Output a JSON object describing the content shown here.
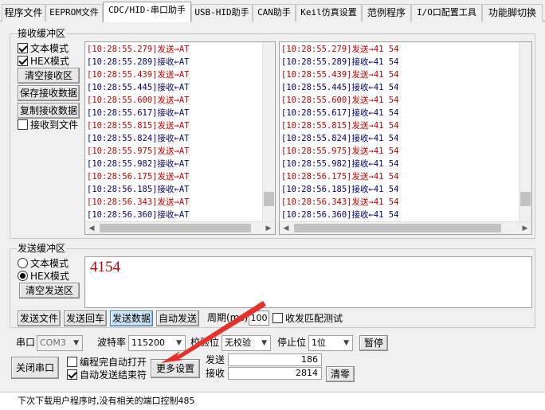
{
  "tabs": [
    {
      "label": "程序文件"
    },
    {
      "label": "EEPROM文件"
    },
    {
      "label": "CDC/HID-串口助手"
    },
    {
      "label": "USB-HID助手"
    },
    {
      "label": "CAN助手"
    },
    {
      "label": "Keil仿真设置"
    },
    {
      "label": "范例程序"
    },
    {
      "label": "I/O口配置工具"
    },
    {
      "label": "功能脚切换"
    }
  ],
  "receive": {
    "group_title": "接收缓冲区",
    "text_mode": "文本模式",
    "hex_mode": "HEX模式",
    "clear_button": "清空接收区",
    "save_button": "保存接收数据",
    "copy_button": "复制接收数据",
    "to_file": "接收到文件",
    "text_log": [
      {
        "text": "[10:28:55.279]发送→AT",
        "dir": "send"
      },
      {
        "text": "[10:28:55.289]接收←AT",
        "dir": "recv"
      },
      {
        "text": "[10:28:55.439]发送→AT",
        "dir": "send"
      },
      {
        "text": "[10:28:55.445]接收←AT",
        "dir": "recv"
      },
      {
        "text": "[10:28:55.600]发送→AT",
        "dir": "send"
      },
      {
        "text": "[10:28:55.617]接收←AT",
        "dir": "recv"
      },
      {
        "text": "[10:28:55.815]发送→AT",
        "dir": "send"
      },
      {
        "text": "[10:28:55.824]接收←AT",
        "dir": "recv"
      },
      {
        "text": "[10:28:55.975]发送→AT",
        "dir": "send"
      },
      {
        "text": "[10:28:55.982]接收←AT",
        "dir": "recv"
      },
      {
        "text": "[10:28:56.175]发送→AT",
        "dir": "send"
      },
      {
        "text": "[10:28:56.185]接收←AT",
        "dir": "recv"
      },
      {
        "text": "[10:28:56.343]发送→AT",
        "dir": "send"
      },
      {
        "text": "[10:28:56.360]接收←AT",
        "dir": "recv"
      }
    ],
    "hex_log": [
      {
        "text": "[10:28:55.279]发送→41 54",
        "dir": "send"
      },
      {
        "text": "[10:28:55.289]接收←41 54",
        "dir": "recv"
      },
      {
        "text": "[10:28:55.439]发送→41 54",
        "dir": "send"
      },
      {
        "text": "[10:28:55.445]接收←41 54",
        "dir": "recv"
      },
      {
        "text": "[10:28:55.600]发送→41 54",
        "dir": "send"
      },
      {
        "text": "[10:28:55.617]接收←41 54",
        "dir": "recv"
      },
      {
        "text": "[10:28:55.815]发送→41 54",
        "dir": "send"
      },
      {
        "text": "[10:28:55.824]接收←41 54",
        "dir": "recv"
      },
      {
        "text": "[10:28:55.975]发送→41 54",
        "dir": "send"
      },
      {
        "text": "[10:28:55.982]接收←41 54",
        "dir": "recv"
      },
      {
        "text": "[10:28:56.175]发送→41 54",
        "dir": "send"
      },
      {
        "text": "[10:28:56.185]接收←41 54",
        "dir": "recv"
      },
      {
        "text": "[10:28:56.343]发送→41 54",
        "dir": "send"
      },
      {
        "text": "[10:28:56.360]接收←41 54",
        "dir": "recv"
      }
    ]
  },
  "send": {
    "group_title": "发送缓冲区",
    "text_mode": "文本模式",
    "hex_mode": "HEX模式",
    "clear_button": "清空发送区",
    "content": "4154",
    "send_file": "发送文件",
    "send_enter": "发送回车",
    "send_data": "发送数据",
    "auto_send": "自动发送",
    "period_label": "周期(ms)",
    "period_value": "100",
    "match_test": "收发匹配测试"
  },
  "port": {
    "port_label": "串口",
    "port_value": "COM3",
    "baud_label": "波特率",
    "baud_value": "115200",
    "parity_label": "校验位",
    "parity_value": "无校验",
    "stop_label": "停止位",
    "stop_value": "1位",
    "pause_button": "暂停",
    "close_button": "关闭串口",
    "auto_open": "编程完自动打开",
    "auto_send_end": "自动发送结束符",
    "more_settings": "更多设置",
    "sent_label": "发送",
    "sent_count": "186",
    "recv_label": "接收",
    "recv_count": "2814",
    "clear_count": "清零"
  },
  "status": {
    "text": "下次下载用户程序时,没有相关的端口控制485"
  },
  "colors": {
    "send": "#c00000",
    "recv": "#00007a",
    "annotation_arrow": "#e8302a"
  }
}
